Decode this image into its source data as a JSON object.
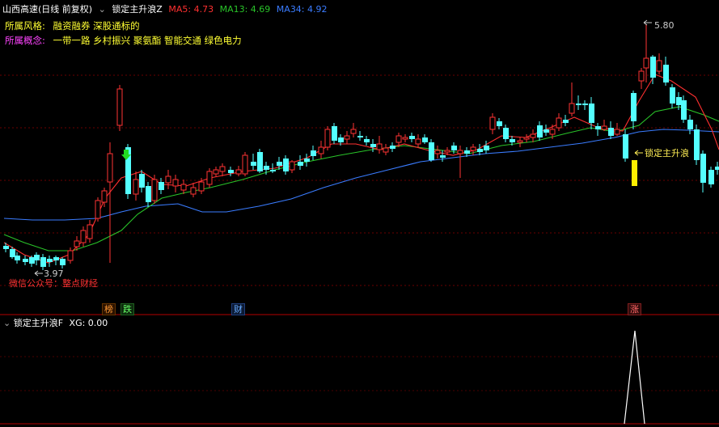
{
  "header": {
    "stock_title": "山西高速(日线 前复权)",
    "indicator_name": "锁定主升浪Z",
    "ma5_label": "MA5: 4.73",
    "ma13_label": "MA13: 4.69",
    "ma34_label": "MA34: 4.92",
    "colors": {
      "ma5": "#ff3030",
      "ma13": "#29c329",
      "ma34": "#3a7cff"
    }
  },
  "info": {
    "style_key": "所属风格:",
    "style_val": "融资融券 深股通标的",
    "concept_key": "所属概念:",
    "concept_val": "一带一路 乡村振兴 聚氨酯 智能交通 绿色电力"
  },
  "annotations": {
    "high_label": "5.80",
    "low_label": "3.97",
    "signal_label": "锁定主升浪",
    "watermark": "微信公众号：整点财经"
  },
  "tags": {
    "bang": "榜",
    "die": "跌",
    "cai": "财",
    "zhang": "涨"
  },
  "sub_panel": {
    "title": "锁定主升浪F",
    "xg_label": "XG: 0.00"
  },
  "chart_data": {
    "type": "candlestick",
    "series": [
      {
        "name": "MA5"
      },
      {
        "name": "MA13"
      },
      {
        "name": "MA34"
      }
    ],
    "price_high": 5.8,
    "price_low": 3.97,
    "xg_signal_spike": 1
  }
}
